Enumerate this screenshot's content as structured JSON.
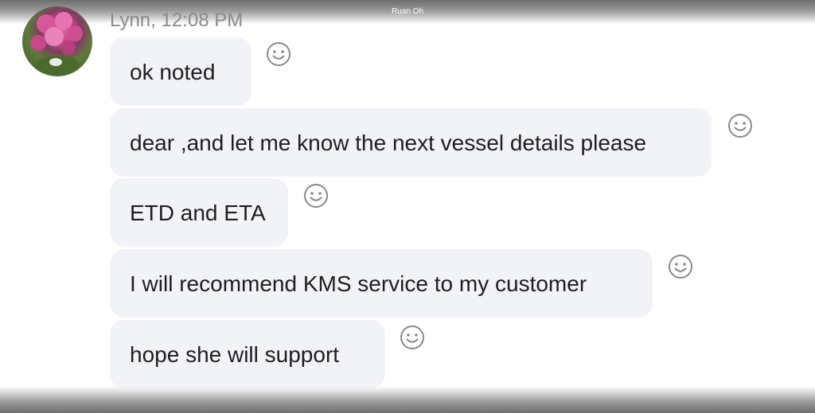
{
  "window": {
    "title": "Ruan Oh"
  },
  "conversation": {
    "sender": {
      "name": "Lynn",
      "time": "12:08 PM",
      "display": "Lynn, 12:08 PM"
    },
    "messages": [
      {
        "text": "ok noted",
        "reaction_icon": "smiley-icon"
      },
      {
        "text": "dear ,and let me know the next vessel details please",
        "reaction_icon": "smiley-icon"
      },
      {
        "text": "ETD and ETA",
        "reaction_icon": "smiley-icon"
      },
      {
        "text": "I will recommend KMS service to my customer",
        "reaction_icon": "smiley-icon"
      },
      {
        "text": "hope she will support",
        "reaction_icon": "smiley-icon"
      }
    ]
  },
  "colors": {
    "bubble_background": "#f1f3f7",
    "message_text": "#1e1e1e",
    "meta_text": "#8a8a8a"
  }
}
